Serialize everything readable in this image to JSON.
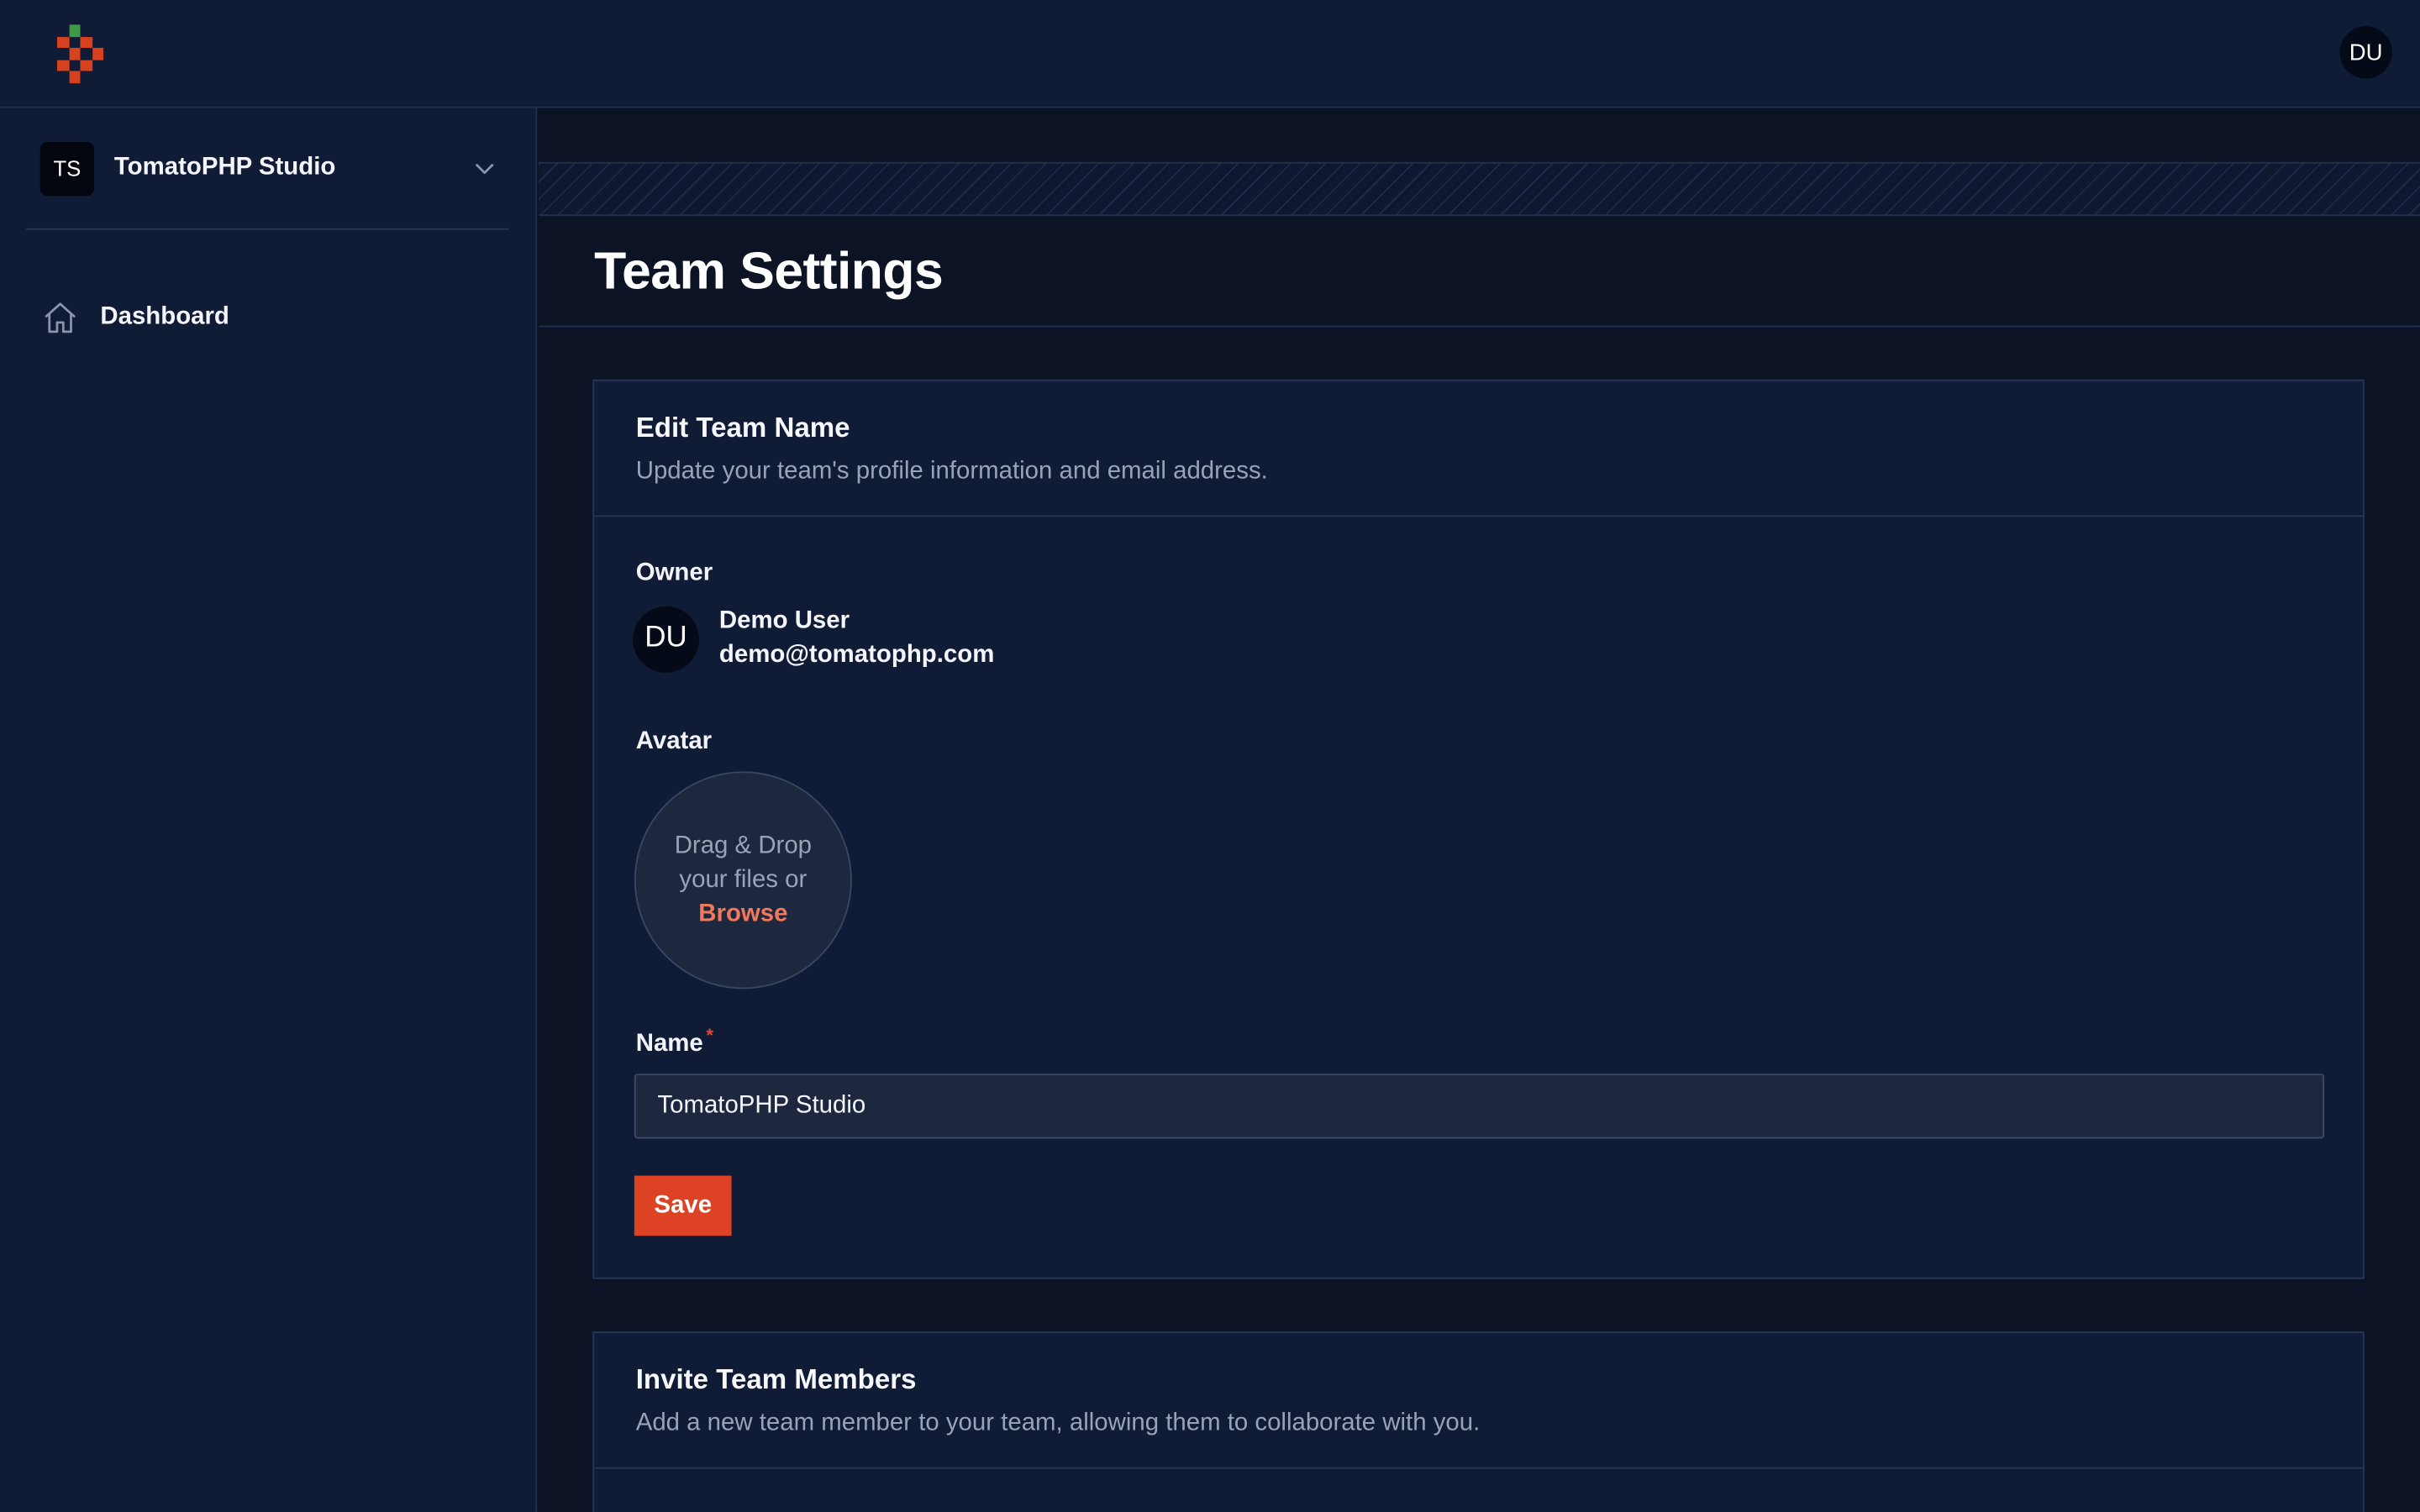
{
  "header": {
    "user_initials": "DU"
  },
  "sidebar": {
    "team": {
      "initials": "TS",
      "name": "TomatoPHP Studio"
    },
    "items": [
      {
        "label": "Dashboard",
        "icon": "home-icon"
      }
    ]
  },
  "page": {
    "title": "Team Settings"
  },
  "edit_team": {
    "title": "Edit Team Name",
    "description": "Update your team's profile information and email address.",
    "owner_label": "Owner",
    "owner": {
      "initials": "DU",
      "name": "Demo User",
      "email": "demo@tomatophp.com"
    },
    "avatar_label": "Avatar",
    "dropzone": {
      "line1": "Drag & Drop",
      "line2": "your files or",
      "browse": "Browse"
    },
    "name_label": "Name",
    "required_mark": "*",
    "name_value": "TomatoPHP Studio",
    "save_label": "Save"
  },
  "invite": {
    "title": "Invite Team Members",
    "description": "Add a new team member to your team, allowing them to collaborate with you."
  },
  "colors": {
    "background": "#0b1324",
    "panel": "#101b35",
    "accent": "#dc4223",
    "browse_link": "#f2785c"
  }
}
